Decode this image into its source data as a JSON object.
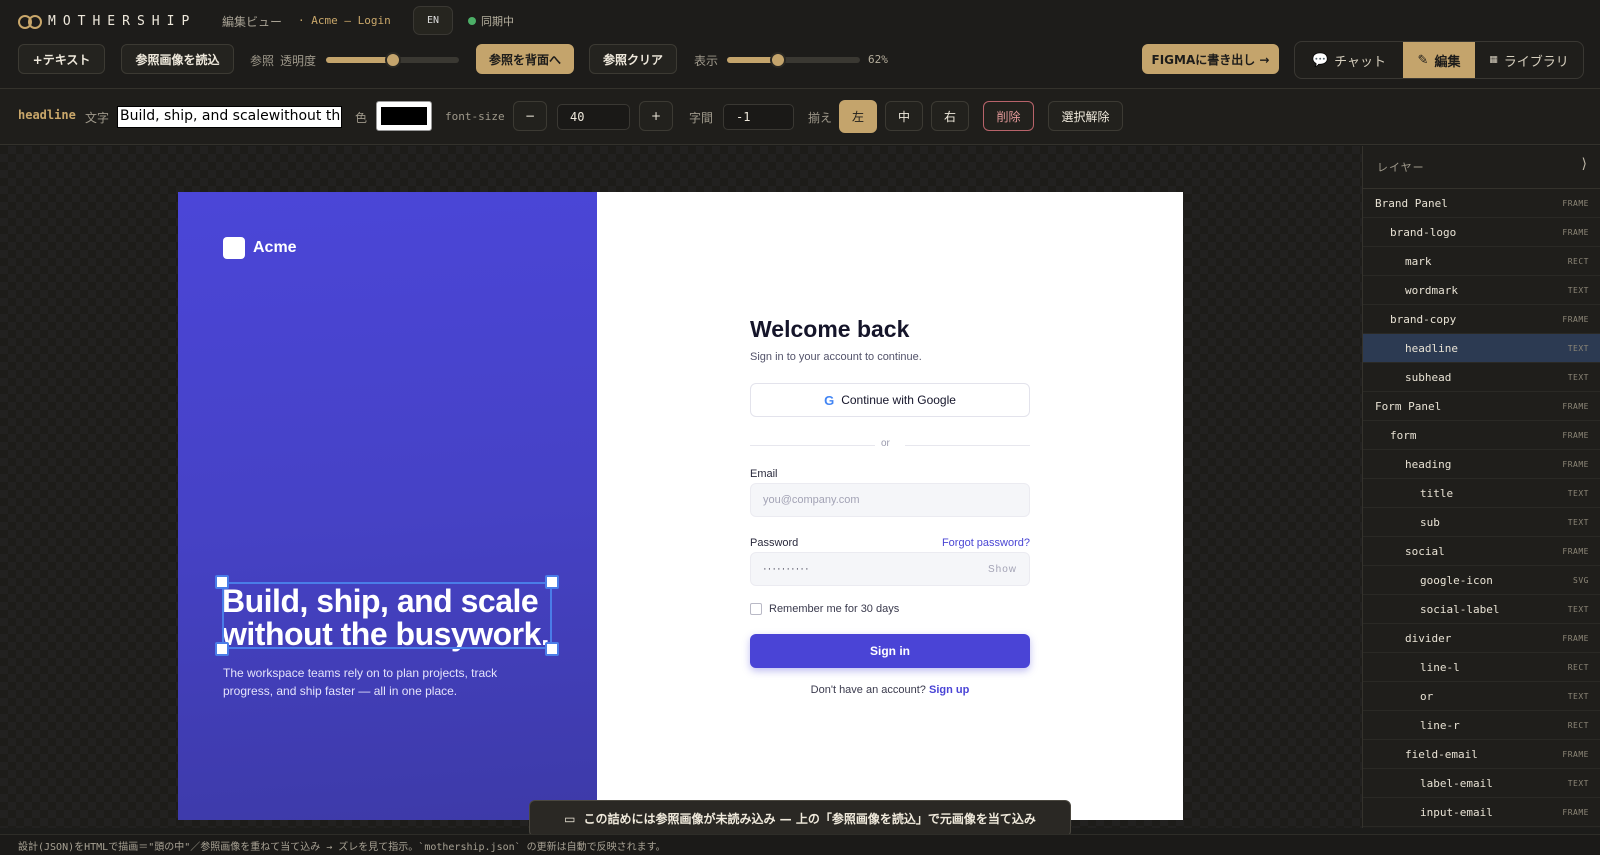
{
  "app": {
    "name": "MOTHERSHIP",
    "view_label": "編集ビュー",
    "project": "· Acme — Login",
    "lang": "EN",
    "sync_status": "同期中"
  },
  "toolbar": {
    "add_text": "+テキスト",
    "load_ref": "参照画像を読込",
    "ref_label": "参照",
    "opacity_label": "透明度",
    "opacity_value": 0.5,
    "ref_to_back": "参照を背面へ",
    "ref_clear": "参照クリア",
    "zoom_label": "表示",
    "zoom_percent": "62%",
    "zoom_value": 0.38,
    "export_figma": "FIGMAに書き出し →"
  },
  "mode_tabs": [
    {
      "label": "チャット",
      "icon": "chat-icon",
      "active": false
    },
    {
      "label": "編集",
      "icon": "pencil-icon",
      "active": true
    },
    {
      "label": "ライブラリ",
      "icon": "library-icon",
      "active": false
    }
  ],
  "props": {
    "selected_name": "headline",
    "text_label": "文字",
    "text_value": "Build, ship, and scalewithout the busywork.",
    "color_label": "色",
    "color_value": "#000000",
    "font_size_label": "font-size",
    "minus": "−",
    "font_size": "40",
    "plus": "+",
    "spacing_label": "字間",
    "spacing": "-1",
    "align_label": "揃え",
    "align_left": "左",
    "align_center": "中",
    "align_right": "右",
    "delete": "削除",
    "deselect": "選択解除"
  },
  "design": {
    "brand_name": "Acme",
    "headline_line1": "Build, ship, and scale",
    "headline_line2": "without the busywork.",
    "subhead": "The workspace teams rely on to plan projects, track progress, and ship faster — all in one place.",
    "form_title": "Welcome back",
    "form_sub": "Sign in to your account to continue.",
    "google_label": "Continue with Google",
    "or": "or",
    "email_label": "Email",
    "email_placeholder": "you@company.com",
    "password_label": "Password",
    "forgot": "Forgot password?",
    "password_value": "··········",
    "show": "Show",
    "remember": "Remember me for 30 days",
    "sign_in": "Sign in",
    "no_account": "Don't have an account?",
    "sign_up": "Sign up"
  },
  "layers": {
    "title": "レイヤー",
    "collapse": "⟩",
    "items": [
      {
        "name": "Brand Panel",
        "type": "FRAME",
        "depth": 0
      },
      {
        "name": "brand-logo",
        "type": "FRAME",
        "depth": 1
      },
      {
        "name": "mark",
        "type": "RECT",
        "depth": 2
      },
      {
        "name": "wordmark",
        "type": "TEXT",
        "depth": 2
      },
      {
        "name": "brand-copy",
        "type": "FRAME",
        "depth": 1
      },
      {
        "name": "headline",
        "type": "TEXT",
        "depth": 2,
        "selected": true
      },
      {
        "name": "subhead",
        "type": "TEXT",
        "depth": 2
      },
      {
        "name": "Form Panel",
        "type": "FRAME",
        "depth": 0
      },
      {
        "name": "form",
        "type": "FRAME",
        "depth": 1
      },
      {
        "name": "heading",
        "type": "FRAME",
        "depth": 2
      },
      {
        "name": "title",
        "type": "TEXT",
        "depth": 3
      },
      {
        "name": "sub",
        "type": "TEXT",
        "depth": 3
      },
      {
        "name": "social",
        "type": "FRAME",
        "depth": 2
      },
      {
        "name": "google-icon",
        "type": "SVG",
        "depth": 3
      },
      {
        "name": "social-label",
        "type": "TEXT",
        "depth": 3
      },
      {
        "name": "divider",
        "type": "FRAME",
        "depth": 2
      },
      {
        "name": "line-l",
        "type": "RECT",
        "depth": 3
      },
      {
        "name": "or",
        "type": "TEXT",
        "depth": 3
      },
      {
        "name": "line-r",
        "type": "RECT",
        "depth": 3
      },
      {
        "name": "field-email",
        "type": "FRAME",
        "depth": 2
      },
      {
        "name": "label-email",
        "type": "TEXT",
        "depth": 3
      },
      {
        "name": "input-email",
        "type": "FRAME",
        "depth": 3
      }
    ]
  },
  "toast": "この詰めには参照画像が未読み込み — 上の「参照画像を読込」で元画像を当て込み",
  "status_bar": "設計(JSON)をHTMLで描画＝\"頭の中\"／参照画像を重ねて当て込み → ズレを見て指示。`mothership.json` の更新は自動で反映されます。"
}
